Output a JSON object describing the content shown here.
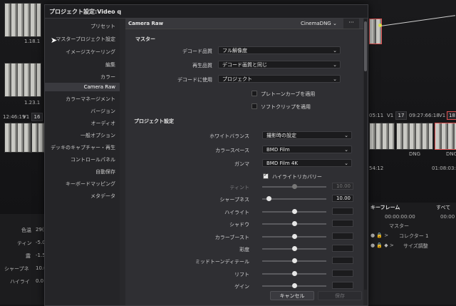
{
  "dialog": {
    "title": "プロジェクト設定:Video q",
    "sidebar": [
      "プリセット",
      "マスタープロジェクト設定",
      "イメージスケーリング",
      "編集",
      "カラー",
      "Camera Raw",
      "カラーマネージメント",
      "バージョン",
      "オーディオ",
      "一般オプション",
      "デッキのキャプチャー・再生",
      "コントロールパネル",
      "自動保存",
      "キーボードマッピング",
      "メタデータ"
    ],
    "active_item": "Camera Raw",
    "content_header": {
      "title": "Camera Raw",
      "format": "CinemaDNG",
      "more": "···"
    },
    "master": {
      "heading": "マスター",
      "rows": [
        {
          "label": "デコード品質",
          "value": "フル解像度"
        },
        {
          "label": "再生品質",
          "value": "デコード画質と同じ"
        },
        {
          "label": "デコードに使用",
          "value": "プロジェクト"
        }
      ],
      "checkboxes": [
        {
          "label": "プレトーンカーブを適用",
          "checked": false
        },
        {
          "label": "ソフトクリップを適用",
          "checked": false
        }
      ]
    },
    "project": {
      "heading": "プロジェクト設定",
      "rows": [
        {
          "label": "ホワイトバランス",
          "value": "撮影時の設定"
        },
        {
          "label": "カラースペース",
          "value": "BMD Film"
        },
        {
          "label": "ガンマ",
          "value": "BMD Film 4K"
        }
      ],
      "highlight_recovery": {
        "label": "ハイライトリカバリー",
        "checked": true
      },
      "sliders": [
        {
          "label": "ティント",
          "value": "10.00",
          "level": 0.5,
          "disabled": true
        },
        {
          "label": "シャープネス",
          "value": "10.00",
          "level": 0.1,
          "disabled": false
        },
        {
          "label": "ハイライト",
          "value": "",
          "level": 0.5,
          "disabled": false
        },
        {
          "label": "シャドウ",
          "value": "",
          "level": 0.5,
          "disabled": false
        },
        {
          "label": "カラーブースト",
          "value": "",
          "level": 0.5,
          "disabled": false
        },
        {
          "label": "彩度",
          "value": "",
          "level": 0.5,
          "disabled": false
        },
        {
          "label": "ミッドトーンディテール",
          "value": "",
          "level": 0.5,
          "disabled": false
        },
        {
          "label": "リフト",
          "value": "",
          "level": 0.5,
          "disabled": false
        },
        {
          "label": "ゲイン",
          "value": "",
          "level": 0.5,
          "disabled": false
        }
      ]
    },
    "buttons": {
      "cancel": "キャンセル",
      "save": "保存"
    }
  },
  "background": {
    "clip_a": "1.18.1",
    "clip_b": "1.23.1",
    "timecode_left": "12:46:19",
    "track_v1": "V1",
    "track_num_left": "16",
    "timecode_mid": "05:11",
    "track_v1_b": "V1",
    "track_17": "17",
    "timecode_right": "09:27:66:18",
    "track_v1_c": "V1",
    "track_18": "18",
    "dng_a": "DNG",
    "dng_b": "DNG",
    "time_54": "54:12",
    "timecode_far": "01:08:03:1",
    "keyframes": "キーフレーム",
    "all": "すべて",
    "kf_time": "00:00:00:00",
    "kf_time2": "00:00",
    "master_label": "マスター",
    "corrector": "コレクター 1",
    "size": "サイズ調整",
    "param_labels": [
      "色温",
      "ティン",
      "露",
      "シャープネ",
      "ハイライ"
    ],
    "param_values": [
      "29(",
      "-5.0",
      "-1.5",
      "10.0",
      "0.0"
    ]
  }
}
